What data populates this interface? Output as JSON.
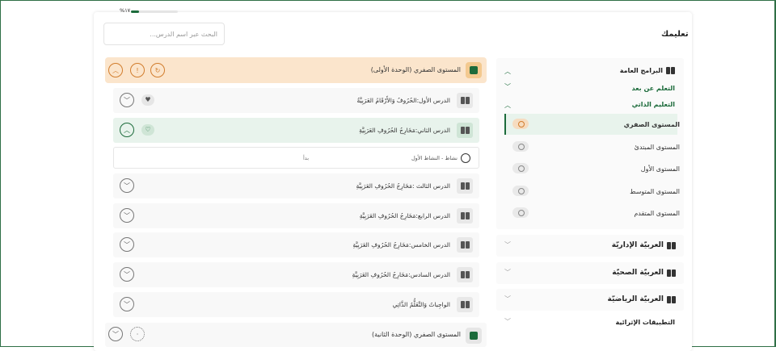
{
  "header": {
    "title": "تعليمك"
  },
  "search": {
    "placeholder": "البحث عبر اسم الدرس..."
  },
  "sidebar": {
    "general_programs": "البرامج العامة",
    "distance_learning": "التعلم عن بعد",
    "self_learning": "التعليم الذاتي",
    "levels": [
      {
        "label": "المستوى الصفري",
        "active": true
      },
      {
        "label": "المستوى المبتدئ",
        "active": false
      },
      {
        "label": "المستوى الأول",
        "active": false
      },
      {
        "label": "المستوى المتوسط",
        "active": false
      },
      {
        "label": "المستوى المتقدم",
        "active": false
      }
    ],
    "categories": [
      "العربيّة الإداريّة",
      "العربيّة الصحيّة",
      "العربيّة الرياضيّة"
    ],
    "enrichment_apps": "التطبيقات الإثرائية"
  },
  "unit1": {
    "label": "المستوى الصفري (الوحدة الأولى)"
  },
  "lessons": [
    {
      "label": "الدرس الأول:الحُرُوفُ وَالأَرْقَامُ العَرَبِيَّةُ",
      "active": false
    },
    {
      "label": "الدرس الثاني:مَخَارِجُ الحُرُوفِ العَرَبِيَّةِ",
      "active": true
    },
    {
      "label": "الدرس الثالث :مَخَارِجُ الحُرُوفِ العَرَبِيَّةِ",
      "active": false
    },
    {
      "label": "الدرس الرابع:مَخَارِجُ الحُرُوفِ العَرَبِيَّةِ",
      "active": false
    },
    {
      "label": "الدرس الخامس:مَخَارِجُ الحُرُوفِ العَرَبِيَّةِ",
      "active": false
    },
    {
      "label": "الدرس السادس:مَخَارِجُ الحُرُوفِ العَرَبِيَّةِ",
      "active": false
    },
    {
      "label": "الواجِباتُ وَالتَّعَلُّمُ الذَّاتِي",
      "active": false
    }
  ],
  "activity": {
    "label": "نشاط - النشاط الأول",
    "status": "بدأ",
    "progress_text": "%١٧",
    "progress": 0.17
  },
  "unit2": {
    "label": "المستوى الصفري (الوحدة الثانية)"
  },
  "colors": {
    "accent": "#1c6b3b",
    "unit_bg": "#fbe5cc",
    "orange": "#d27d2d"
  }
}
